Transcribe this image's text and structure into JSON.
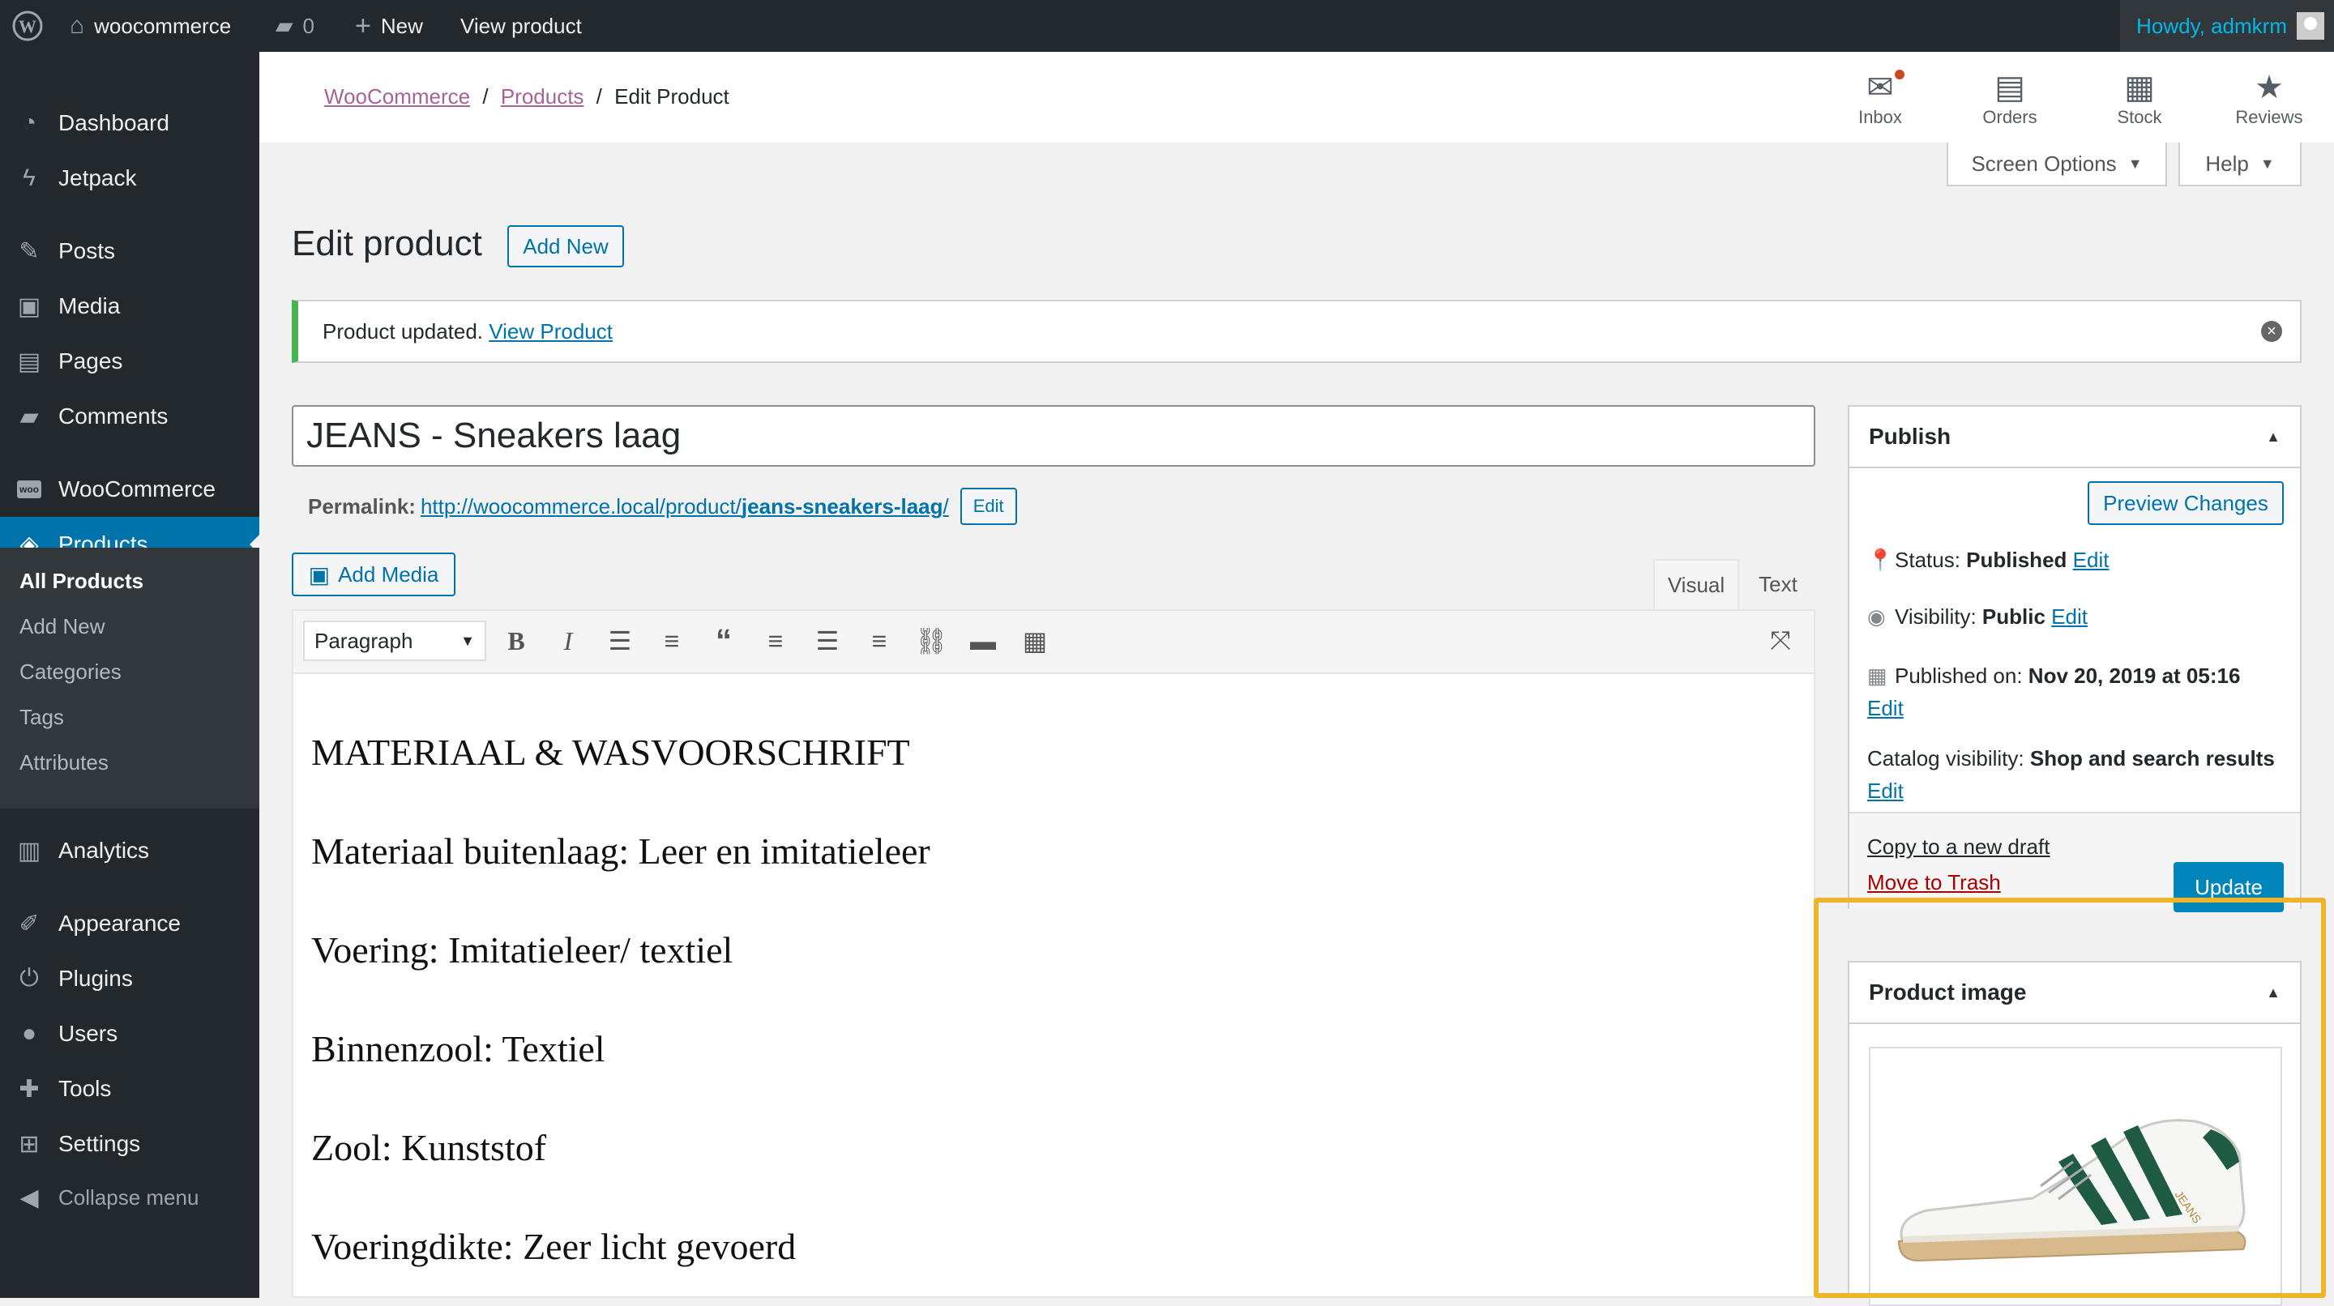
{
  "admin_bar": {
    "site_name": "woocommerce",
    "comments_count": "0",
    "new_label": "New",
    "view_product": "View product",
    "howdy": "Howdy, admkrm"
  },
  "sidebar": {
    "items": [
      {
        "label": "Dashboard",
        "icon": "dashboard-icon"
      },
      {
        "label": "Jetpack",
        "icon": "jetpack-icon"
      },
      {
        "label": "Posts",
        "icon": "pin-icon"
      },
      {
        "label": "Media",
        "icon": "media-icon"
      },
      {
        "label": "Pages",
        "icon": "pages-icon"
      },
      {
        "label": "Comments",
        "icon": "comment-icon"
      },
      {
        "label": "WooCommerce",
        "icon": "woo-icon"
      },
      {
        "label": "Products",
        "icon": "product-box-icon"
      },
      {
        "label": "Analytics",
        "icon": "bar-chart-icon"
      },
      {
        "label": "Appearance",
        "icon": "brush-icon"
      },
      {
        "label": "Plugins",
        "icon": "plug-icon"
      },
      {
        "label": "Users",
        "icon": "user-icon"
      },
      {
        "label": "Tools",
        "icon": "wrench-icon"
      },
      {
        "label": "Settings",
        "icon": "settings-icon"
      },
      {
        "label": "Collapse menu",
        "icon": "collapse-icon"
      }
    ],
    "submenu": [
      "All Products",
      "Add New",
      "Categories",
      "Tags",
      "Attributes"
    ]
  },
  "breadcrumb": {
    "woocommerce": "WooCommerce",
    "products": "Products",
    "current": "Edit Product",
    "sep": "/"
  },
  "wc_actions": {
    "inbox": "Inbox",
    "orders": "Orders",
    "stock": "Stock",
    "reviews": "Reviews"
  },
  "screen_options": "Screen Options",
  "help": "Help",
  "page_title": "Edit product",
  "add_new": "Add New",
  "notice": {
    "text": "Product updated.",
    "link": "View Product"
  },
  "title_value": "JEANS - Sneakers laag",
  "permalink": {
    "label": "Permalink:",
    "url_base": "http://woocommerce.local/product/",
    "slug": "jeans-sneakers-laag",
    "trail": "/",
    "edit": "Edit"
  },
  "add_media": "Add Media",
  "editor_tabs": {
    "visual": "Visual",
    "text": "Text"
  },
  "format_select": "Paragraph",
  "content_lines": [
    "MATERIAAL & WASVOORSCHRIFT",
    "Materiaal buitenlaag: Leer en imitatieleer",
    "Voering: Imitatieleer/ textiel",
    "Binnenzool: Textiel",
    "Zool: Kunststof",
    "Voeringdikte: Zeer licht gevoerd"
  ],
  "publish": {
    "title": "Publish",
    "preview": "Preview Changes",
    "status_label": "Status:",
    "status_value": "Published",
    "visibility_label": "Visibility:",
    "visibility_value": "Public",
    "published_label": "Published on:",
    "published_value": "Nov 20, 2019 at 05:16",
    "catalog_label": "Catalog visibility:",
    "catalog_value": "Shop and search results",
    "edit": "Edit",
    "copy_draft": "Copy to a new draft",
    "trash": "Move to Trash",
    "update": "Update"
  },
  "product_image": {
    "title": "Product image",
    "shoe_brand_text": "JEANS"
  },
  "colors": {
    "accent": "#0073aa",
    "highlight": "#f0b428",
    "success": "#46b450",
    "sidebar": "#23282d",
    "link_woo": "#a46497"
  }
}
